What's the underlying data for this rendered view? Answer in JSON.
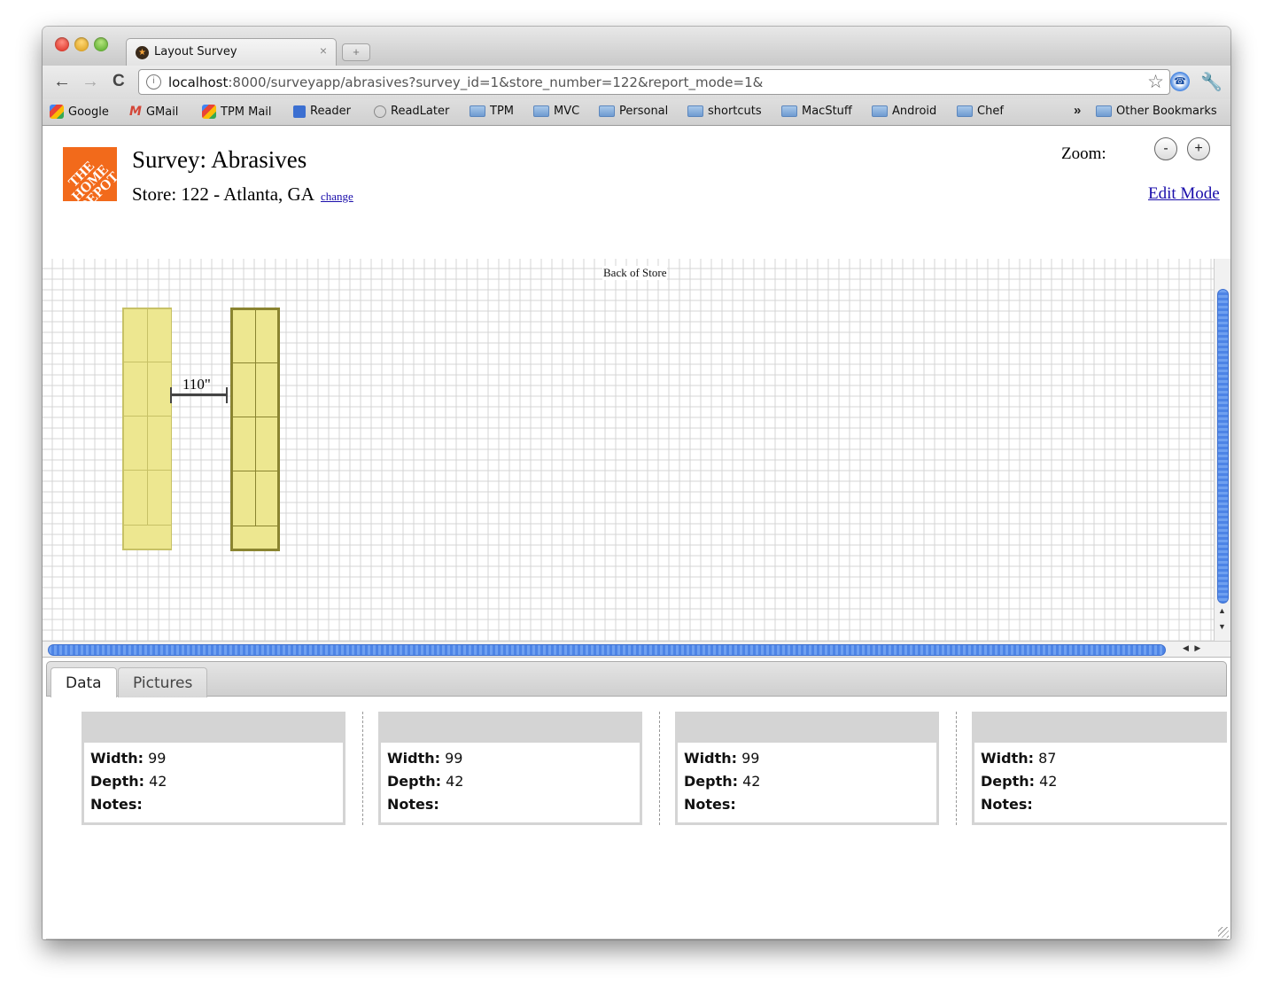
{
  "browser": {
    "tab_title": "Layout Survey",
    "tab_close": "×",
    "new_tab": "+",
    "url_host": "localhost",
    "url_rest": ":8000/surveyapp/abrasives?survey_id=1&store_number=122&report_mode=1&",
    "back": "←",
    "forward": "→",
    "reload": "C",
    "star": "☆",
    "wrench": "🔧",
    "bookmarks": [
      "Google",
      "GMail",
      "TPM Mail",
      "Reader",
      "ReadLater",
      "TPM",
      "MVC",
      "Personal",
      "shortcuts",
      "MacStuff",
      "Android",
      "Chef"
    ],
    "bookmarks_overflow": "»",
    "other_bookmarks": "Other Bookmarks"
  },
  "header": {
    "logo_text": "THE HOME DEPOT",
    "title": "Survey: Abrasives",
    "store": "Store: 122 - Atlanta, GA",
    "change_link": "change",
    "zoom_label": "Zoom:",
    "zoom_out": "-",
    "zoom_in": "+",
    "edit_mode": "Edit Mode"
  },
  "canvas": {
    "back_label": "Back of Store",
    "dimension_label": "110\""
  },
  "tabs": [
    "Data",
    "Pictures"
  ],
  "cards": [
    {
      "width_label": "Width:",
      "width": "99",
      "depth_label": "Depth:",
      "depth": "42",
      "notes_label": "Notes:"
    },
    {
      "width_label": "Width:",
      "width": "99",
      "depth_label": "Depth:",
      "depth": "42",
      "notes_label": "Notes:"
    },
    {
      "width_label": "Width:",
      "width": "99",
      "depth_label": "Depth:",
      "depth": "42",
      "notes_label": "Notes:"
    },
    {
      "width_label": "Width:",
      "width": "87",
      "depth_label": "Depth:",
      "depth": "42",
      "notes_label": "Notes:"
    }
  ]
}
